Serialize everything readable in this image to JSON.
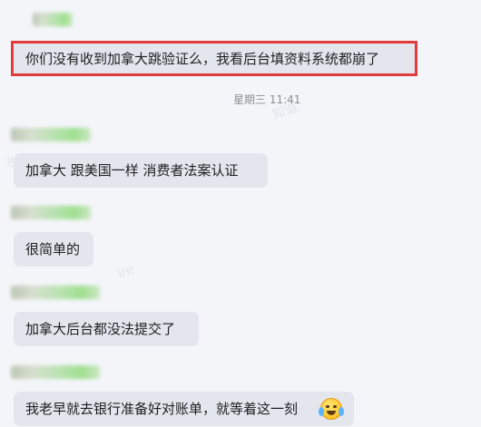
{
  "timestamp": "星期三 11:41",
  "watermarks": [
    "知道",
    "8",
    "ire",
    "知道"
  ],
  "messages": [
    {
      "text": "你们没有收到加拿大跳验证么，我看后台填资料系统都崩了",
      "highlighted": true
    },
    {
      "text": "加拿大 跟美国一样 消费者法案认证"
    },
    {
      "text": "很简单的"
    },
    {
      "text": "加拿大后台都没法提交了"
    },
    {
      "text": "我老早就去银行准备好对账单，就等着这一刻",
      "emoji": "crying-laughing-face"
    }
  ],
  "colors": {
    "background": "#f4f5f9",
    "bubble": "#e4e6ee",
    "highlight_border": "#e23b3b",
    "timestamp": "#8e8e8e"
  }
}
